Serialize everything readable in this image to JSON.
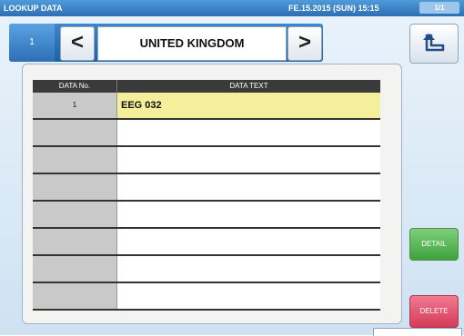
{
  "titlebar": {
    "title": "LOOKUP DATA",
    "datetime": "FE.15.2015 (SUN) 15:15",
    "page_indicator": "1/1"
  },
  "nav": {
    "number": "1",
    "prev_label": "<",
    "next_label": ">",
    "title": "UNITED KINGDOM",
    "back_icon": "return-arrow-icon"
  },
  "table": {
    "headers": {
      "no": "DATA No.",
      "text": "DATA TEXT"
    },
    "rows": [
      {
        "no": "1",
        "text": "EEG 032"
      },
      {
        "no": "",
        "text": ""
      },
      {
        "no": "",
        "text": ""
      },
      {
        "no": "",
        "text": ""
      },
      {
        "no": "",
        "text": ""
      },
      {
        "no": "",
        "text": ""
      },
      {
        "no": "",
        "text": ""
      },
      {
        "no": "",
        "text": ""
      }
    ]
  },
  "buttons": {
    "detail": "DETAIL",
    "delete": "DELETE"
  },
  "colors": {
    "titlebar": "#2c6fb3",
    "selected_row": "#f3ef9a",
    "detail": "#3fa23c",
    "delete": "#d63a5a"
  }
}
